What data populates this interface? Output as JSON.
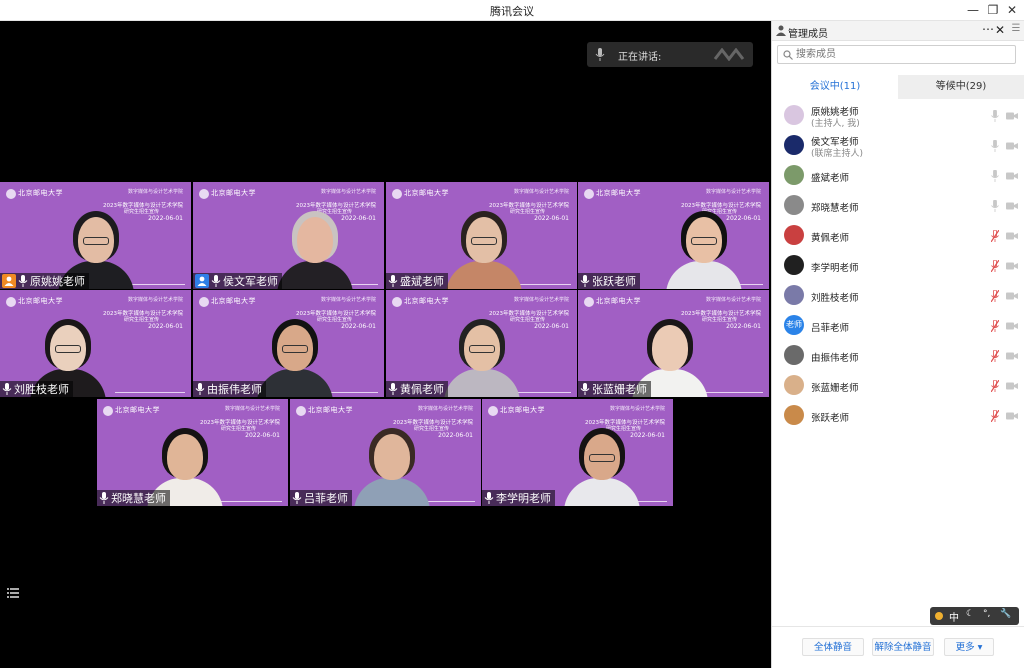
{
  "window": {
    "title": "腾讯会议",
    "controls": [
      "minimize-icon",
      "restore-icon",
      "close-icon"
    ]
  },
  "speaking": {
    "label": "正在讲话:"
  },
  "tiles": [
    {
      "name": "原姚姚老师",
      "host": true,
      "host_color": "#f08a24",
      "cohost": false
    },
    {
      "name": "侯文军老师",
      "host": false,
      "cohost": true,
      "host_color": "#2f7fe8"
    },
    {
      "name": "盛斌老师",
      "host": false,
      "cohost": false
    },
    {
      "name": "张跃老师",
      "host": false,
      "cohost": false
    },
    {
      "name": "刘胜枝老师",
      "host": false,
      "cohost": false
    },
    {
      "name": "由振伟老师",
      "host": false,
      "cohost": false
    },
    {
      "name": "黄佩老师",
      "host": false,
      "cohost": false
    },
    {
      "name": "张蓝姗老师",
      "host": false,
      "cohost": false
    },
    {
      "name": "郑晓慧老师",
      "host": false,
      "cohost": false
    },
    {
      "name": "吕菲老师",
      "host": false,
      "cohost": false
    },
    {
      "name": "李学明老师",
      "host": false,
      "cohost": false
    }
  ],
  "tile_banner": {
    "school": "北京邮电大学",
    "college": "数字媒体与设计艺术学院",
    "event": "2023年数字媒体与设计艺术学院",
    "sub": "研究生招生宣传",
    "date": "2022-06-01"
  },
  "panel": {
    "title": "管理成员",
    "search_placeholder": "搜索成员",
    "tabs": [
      {
        "label": "会议中(11)",
        "active": true
      },
      {
        "label": "等候中(29)",
        "active": false
      }
    ],
    "members": [
      {
        "name": "原姚姚老师",
        "role": "(主持人, 我)",
        "avatar_color": "#d9c6e0",
        "mic_muted": false
      },
      {
        "name": "侯文军老师",
        "role": "(联席主持人)",
        "avatar_color": "#1a2a6a",
        "mic_muted": false
      },
      {
        "name": "盛斌老师",
        "role": "",
        "avatar_color": "#7c9a6a",
        "mic_muted": false
      },
      {
        "name": "郑晓慧老师",
        "role": "",
        "avatar_color": "#8a8a8a",
        "mic_muted": false
      },
      {
        "name": "黄佩老师",
        "role": "",
        "avatar_color": "#c94040",
        "mic_muted": true
      },
      {
        "name": "李学明老师",
        "role": "",
        "avatar_color": "#202020",
        "mic_muted": true
      },
      {
        "name": "刘胜枝老师",
        "role": "",
        "avatar_color": "#7a7aa8",
        "mic_muted": true
      },
      {
        "name": "吕菲老师",
        "role": "",
        "avatar_color": "#2b83e8",
        "avatar_text": "老师",
        "mic_muted": true
      },
      {
        "name": "由振伟老师",
        "role": "",
        "avatar_color": "#6a6a6a",
        "mic_muted": true
      },
      {
        "name": "张蓝姗老师",
        "role": "",
        "avatar_color": "#d9b08a",
        "mic_muted": true
      },
      {
        "name": "张跃老师",
        "role": "",
        "avatar_color": "#c98a4a",
        "mic_muted": true
      }
    ],
    "footer": {
      "mute_all": "全体静音",
      "unmute_all": "解除全体静音",
      "more": "更多"
    }
  },
  "ime": {
    "mode": "中"
  },
  "colors": {
    "tile_bg": "#a15fc4",
    "accent": "#2471d6",
    "muted_red": "#e05050"
  }
}
